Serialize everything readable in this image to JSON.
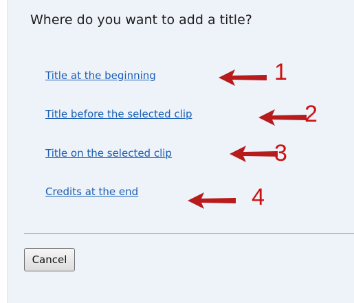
{
  "dialog": {
    "question": "Where do you want to add a title?",
    "options": [
      {
        "label": "Title at the beginning",
        "annotation": "1"
      },
      {
        "label": "Title before the selected clip",
        "annotation": "2"
      },
      {
        "label": "Title on the selected clip",
        "annotation": "3"
      },
      {
        "label": "Credits at the end",
        "annotation": "4"
      }
    ],
    "cancel_label": "Cancel"
  },
  "colors": {
    "panel_background": "#eef2f9",
    "link": "#1a5fb4",
    "annotation": "#cc1111"
  },
  "icons": {
    "annotation_arrow": "arrow-left-icon"
  }
}
